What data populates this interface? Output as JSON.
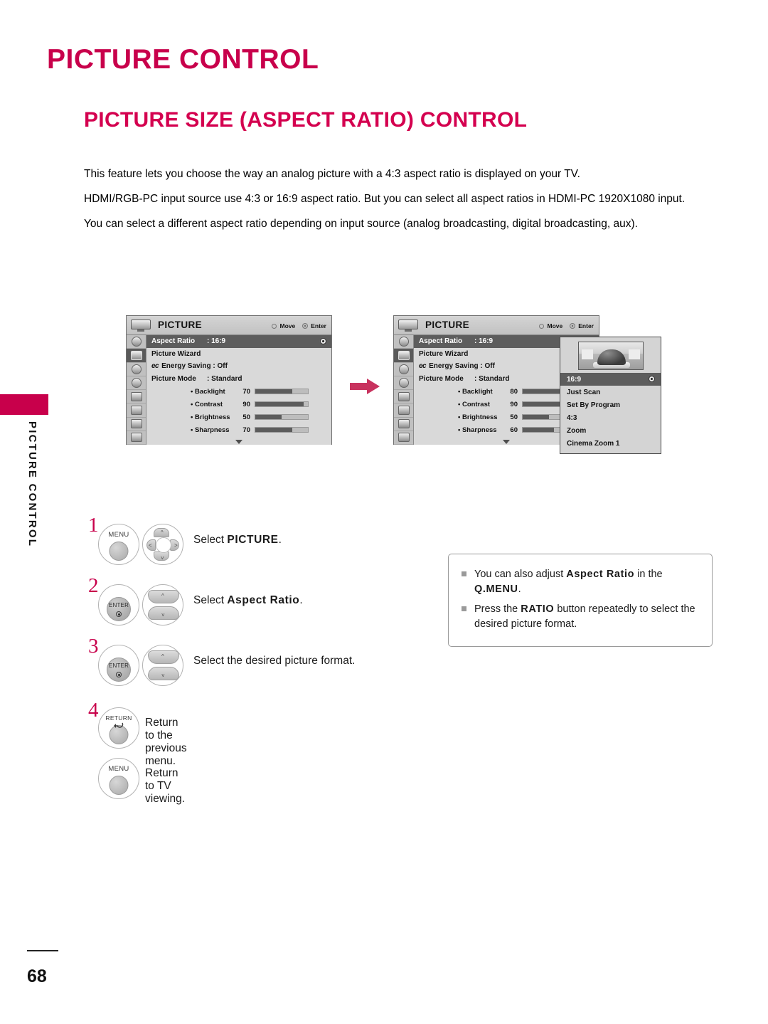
{
  "page": {
    "title": "PICTURE CONTROL",
    "section_title": "PICTURE SIZE (ASPECT RATIO) CONTROL",
    "side_tab_text": "PICTURE CONTROL",
    "page_number": "68",
    "accent_color": "#C8004B"
  },
  "intro": {
    "p1": "This feature lets you choose the way an analog picture with a 4:3 aspect ratio is displayed on your TV.",
    "p2": "HDMI/RGB-PC input source use 4:3 or 16:9 aspect ratio. But you can select all aspect ratios in HDMI-PC 1920X1080 input.",
    "p3": "You can select a different aspect ratio depending on input source (analog broadcasting, digital broadcasting, aux)."
  },
  "osd": {
    "title": "PICTURE",
    "hint_move": "Move",
    "hint_enter": "Enter",
    "menu1": {
      "aspect_ratio_label": "Aspect Ratio",
      "aspect_ratio_value": ": 16:9",
      "picture_wizard": "Picture Wizard",
      "energy_saving_label": "Energy Saving : Off",
      "energy_icon": "ec",
      "picture_mode_label": "Picture Mode",
      "picture_mode_value": ": Standard",
      "sliders": [
        {
          "name": "• Backlight",
          "value": "70",
          "pct": 70
        },
        {
          "name": "• Contrast",
          "value": "90",
          "pct": 92
        },
        {
          "name": "• Brightness",
          "value": "50",
          "pct": 50
        },
        {
          "name": "• Sharpness",
          "value": "70",
          "pct": 70
        }
      ]
    },
    "menu2": {
      "aspect_ratio_label": "Aspect Ratio",
      "aspect_ratio_value": ": 16:9",
      "picture_wizard": "Picture Wizard",
      "energy_saving_label": "Energy Saving : Off",
      "energy_icon": "ec",
      "picture_mode_label": "Picture Mode",
      "picture_mode_value": ": Standard",
      "sliders": [
        {
          "name": "• Backlight",
          "value": "80",
          "pct": 80
        },
        {
          "name": "• Contrast",
          "value": "90",
          "pct": 92
        },
        {
          "name": "• Brightness",
          "value": "50",
          "pct": 50
        },
        {
          "name": "• Sharpness",
          "value": "60",
          "pct": 60
        }
      ]
    },
    "dropdown": {
      "items": [
        {
          "label": "16:9",
          "selected": true
        },
        {
          "label": "Just Scan",
          "selected": false
        },
        {
          "label": "Set By Program",
          "selected": false
        },
        {
          "label": "4:3",
          "selected": false
        },
        {
          "label": "Zoom",
          "selected": false
        },
        {
          "label": "Cinema Zoom 1",
          "selected": false
        }
      ]
    }
  },
  "steps": [
    {
      "number": "1",
      "button_label": "MENU",
      "text_prefix": "Select ",
      "text_bold": "PICTURE",
      "text_suffix": "."
    },
    {
      "number": "2",
      "button_label": "ENTER",
      "text_prefix": "Select ",
      "text_bold": "Aspect Ratio",
      "text_suffix": "."
    },
    {
      "number": "3",
      "button_label": "ENTER",
      "text_prefix": "Select the desired picture format.",
      "text_bold": "",
      "text_suffix": ""
    }
  ],
  "tails": [
    {
      "number": "4",
      "button_label": "RETURN",
      "text": "Return to the previous menu."
    },
    {
      "number": "",
      "button_label": "MENU",
      "text": "Return to TV viewing."
    }
  ],
  "note": {
    "item1_pre": "You can also adjust ",
    "item1_b1": "Aspect Ratio",
    "item1_mid": " in the ",
    "item1_b2": "Q.MENU",
    "item1_post": ".",
    "item2_pre": "Press the ",
    "item2_b1": "RATIO",
    "item2_post": " button repeatedly to select the desired picture format."
  }
}
